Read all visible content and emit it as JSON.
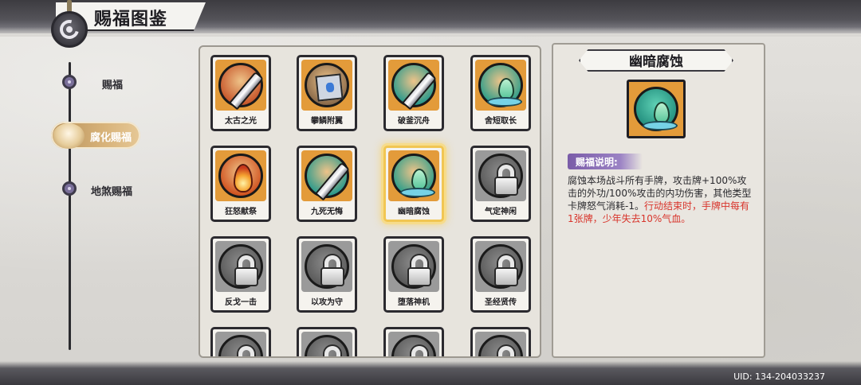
{
  "header": {
    "title": "赐福图鉴"
  },
  "sidebar": {
    "items": [
      {
        "label": "赐福",
        "active": false
      },
      {
        "label": "腐化赐福",
        "active": true
      },
      {
        "label": "地煞赐福",
        "active": false
      }
    ]
  },
  "grid": {
    "cards": [
      {
        "label": "太古之光",
        "icon": "axe-blade-orb-icon",
        "bg": "#e39b3a",
        "orb": "#c7562a",
        "locked": false,
        "selected": false
      },
      {
        "label": "攀鳞附翼",
        "icon": "scroll-book-icon",
        "bg": "#e39b3a",
        "orb": "#8a6a4a",
        "locked": false,
        "selected": false
      },
      {
        "label": "破釜沉舟",
        "icon": "sword-orb-icon",
        "bg": "#e39b3a",
        "orb": "#2b9a8c",
        "locked": false,
        "selected": false
      },
      {
        "label": "舍短取长",
        "icon": "water-drop-icon",
        "bg": "#e39b3a",
        "orb": "#2c9e8a",
        "locked": false,
        "selected": false
      },
      {
        "label": "狂怒献祭",
        "icon": "flame-orb-icon",
        "bg": "#e39b3a",
        "orb": "#d0521f",
        "locked": false,
        "selected": false
      },
      {
        "label": "九死无悔",
        "icon": "sword-orb-icon",
        "bg": "#e39b3a",
        "orb": "#2b9a8c",
        "locked": false,
        "selected": false
      },
      {
        "label": "幽暗腐蚀",
        "icon": "water-drop-icon",
        "bg": "#e39b3a",
        "orb": "#2c9e8a",
        "locked": false,
        "selected": true
      },
      {
        "label": "气定神闲",
        "icon": "lock-icon",
        "bg": "#9a9a9a",
        "orb": "#5a5a5a",
        "locked": true,
        "selected": false
      },
      {
        "label": "反戈一击",
        "icon": "lock-icon",
        "bg": "#9a9a9a",
        "orb": "#5a5a5a",
        "locked": true,
        "selected": false
      },
      {
        "label": "以攻为守",
        "icon": "lock-icon",
        "bg": "#9a9a9a",
        "orb": "#5a5a5a",
        "locked": true,
        "selected": false
      },
      {
        "label": "堕落神机",
        "icon": "lock-icon",
        "bg": "#9a9a9a",
        "orb": "#5a5a5a",
        "locked": true,
        "selected": false
      },
      {
        "label": "圣经贤传",
        "icon": "lock-icon",
        "bg": "#9a9a9a",
        "orb": "#5a5a5a",
        "locked": true,
        "selected": false
      },
      {
        "label": "",
        "icon": "lock-icon",
        "bg": "#9a9a9a",
        "orb": "#5a5a5a",
        "locked": true,
        "selected": false
      },
      {
        "label": "",
        "icon": "lock-icon",
        "bg": "#9a9a9a",
        "orb": "#5a5a5a",
        "locked": true,
        "selected": false
      },
      {
        "label": "",
        "icon": "lock-icon",
        "bg": "#9a9a9a",
        "orb": "#5a5a5a",
        "locked": true,
        "selected": false
      },
      {
        "label": "",
        "icon": "lock-icon",
        "bg": "#9a9a9a",
        "orb": "#5a5a5a",
        "locked": true,
        "selected": false
      }
    ]
  },
  "detail": {
    "title": "幽暗腐蚀",
    "icon": "water-drop-icon",
    "desc_tag": "赐福说明:",
    "desc_normal": "腐蚀本场战斗所有手牌，攻击牌+100%攻击的外功/100%攻击的内功伤害，其他类型卡牌怒气消耗-1。",
    "desc_warning": "行动结束时，手牌中每有1张牌，少年失去10%气血。"
  },
  "footer": {
    "uid": "UID: 134-204033237"
  },
  "colors": {
    "accent_gold": "#d8b37a",
    "tag_purple": "#7a5ca8",
    "warning_red": "#d8342b"
  }
}
